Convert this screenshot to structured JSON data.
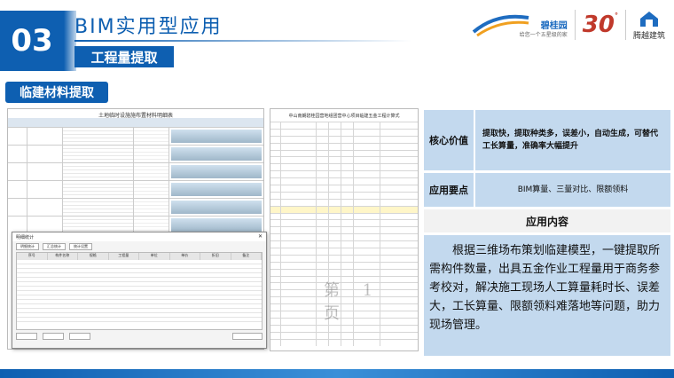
{
  "header": {
    "number": "03",
    "title": "BIM实用型应用",
    "subtitle": "工程量提取"
  },
  "logos": {
    "logo1_name": "碧桂园",
    "logo1_tagline": "给您一个五星级的家",
    "logo2_text": "30",
    "logo3_name": "腾越建筑"
  },
  "section": {
    "label": "临建材料提取"
  },
  "screenshot1": {
    "sheet_title": "土地临时设施施布置材料明细表",
    "dialog_title": "明细统计",
    "dialog_tabs": [
      "明细统计",
      "汇总统计",
      "统计设置"
    ],
    "column_headers": [
      "序号",
      "构件名称",
      "规格",
      "工程量",
      "单位",
      "单价",
      "折旧",
      "备注"
    ]
  },
  "screenshot2": {
    "title": "中山南朗碧桂园营地组团营中心项目临建五金工程计算式",
    "watermark": "第 1 页"
  },
  "panel": {
    "core_value_label": "核心价值",
    "core_value_text": "提取快，提取种类多，误差小，自动生成，可替代工长算量，准确率大幅提升",
    "key_points_label": "应用要点",
    "key_points_text": "BIM算量、三量对比、限额领料",
    "content_heading": "应用内容",
    "content_text": "根据三维场布策划临建模型，一键提取所需构件数量，出具五金作业工程量用于商务参考校对，解决施工现场人工算量耗时长、误差大，工长算量、限额领料难落地等问题，助力现场管理。"
  },
  "colors": {
    "brand_blue": "#0e5fb1",
    "panel_blue": "#c3d9ee"
  }
}
